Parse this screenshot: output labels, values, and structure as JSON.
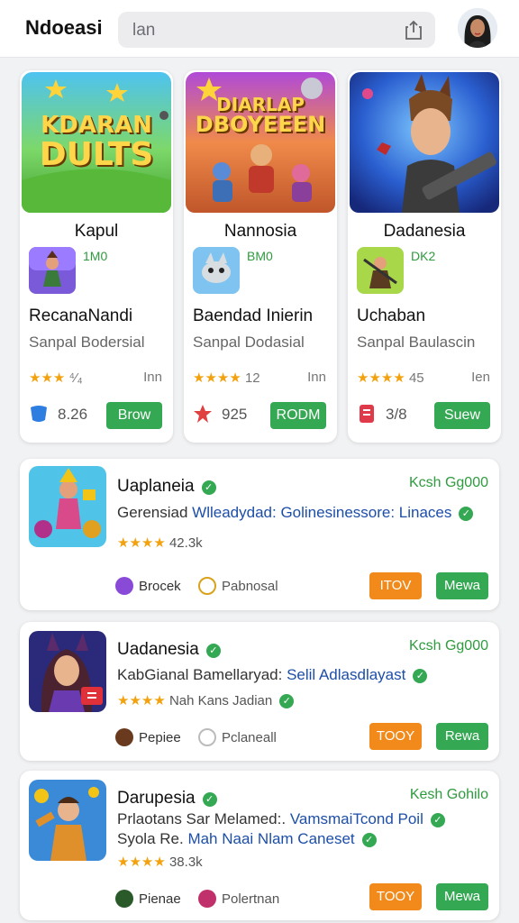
{
  "header": {
    "title": "Ndoeasi",
    "search_placeholder": "lan"
  },
  "top_cards": [
    {
      "banner_text": [
        "KDARAN",
        "DULTS"
      ],
      "name": "Kapul",
      "code": "1M0",
      "title": "RecanaNandi",
      "subtitle": "Sanpal Bodersial",
      "stars": "★★★",
      "rating_text": "⁴⁄₄",
      "tail": "Inn",
      "foot_value": "8.26",
      "button": "Brow"
    },
    {
      "banner_text": [
        "DIARLAP",
        "DBOYEEEN"
      ],
      "name": "Nannosia",
      "code": "BM0",
      "title": "Baendad Inierin",
      "subtitle": "Sanpal Dodasial",
      "stars": "★★★★",
      "rating_text": "12",
      "tail": "Inn",
      "foot_value": "925",
      "button": "RODM"
    },
    {
      "banner_text": [],
      "name": "Dadanesia",
      "code": "DK2",
      "title": "Uchaban",
      "subtitle": "Sanpal Baulascin",
      "stars": "★★★★",
      "rating_text": "45",
      "tail": "Ien",
      "foot_value": "3/8",
      "button": "Suew"
    }
  ],
  "list_items": [
    {
      "name": "Uaplaneia",
      "price": "Kcsh Gg000",
      "desc_prefix": "Gerensiad",
      "desc_highlight": "Wlleadydad: Golinesinessore: Linaces",
      "desc2_prefix": "",
      "desc2_highlight": "",
      "stars": "★★★★",
      "rating": "42.3k",
      "dev1": "Brocek",
      "dev2": "Pabnosal",
      "btn1": "ITOV",
      "btn2": "Mewa"
    },
    {
      "name": "Uadanesia",
      "price": "Kcsh Gg000",
      "desc_prefix": "KabGianal Bamellaryad:",
      "desc_highlight": "Selil Adlasdlayast",
      "desc2_prefix": "",
      "desc2_highlight": "",
      "stars": "★★★★",
      "rating": "Nah Kans Jadian",
      "dev1": "Pepiee",
      "dev2": "Pclaneall",
      "btn1": "TOOY",
      "btn2": "Rewa"
    },
    {
      "name": "Darupesia",
      "price": "Kesh Gohilo",
      "desc_prefix": "Prlaotans Sar Melamed:.",
      "desc_highlight": "VamsmaiTcond Poil",
      "desc2_prefix": "Syola Re.",
      "desc2_highlight": "Mah Naai Nlam Caneset",
      "stars": "★★★★",
      "rating": "38.3k",
      "dev1": "Pienae",
      "dev2": "Polertnan",
      "btn1": "TOOY",
      "btn2": "Mewa"
    }
  ],
  "colors": {
    "green": "#35a853",
    "orange": "#f28a1b",
    "star": "#f2a20f",
    "link_blue": "#1d4ea8"
  }
}
